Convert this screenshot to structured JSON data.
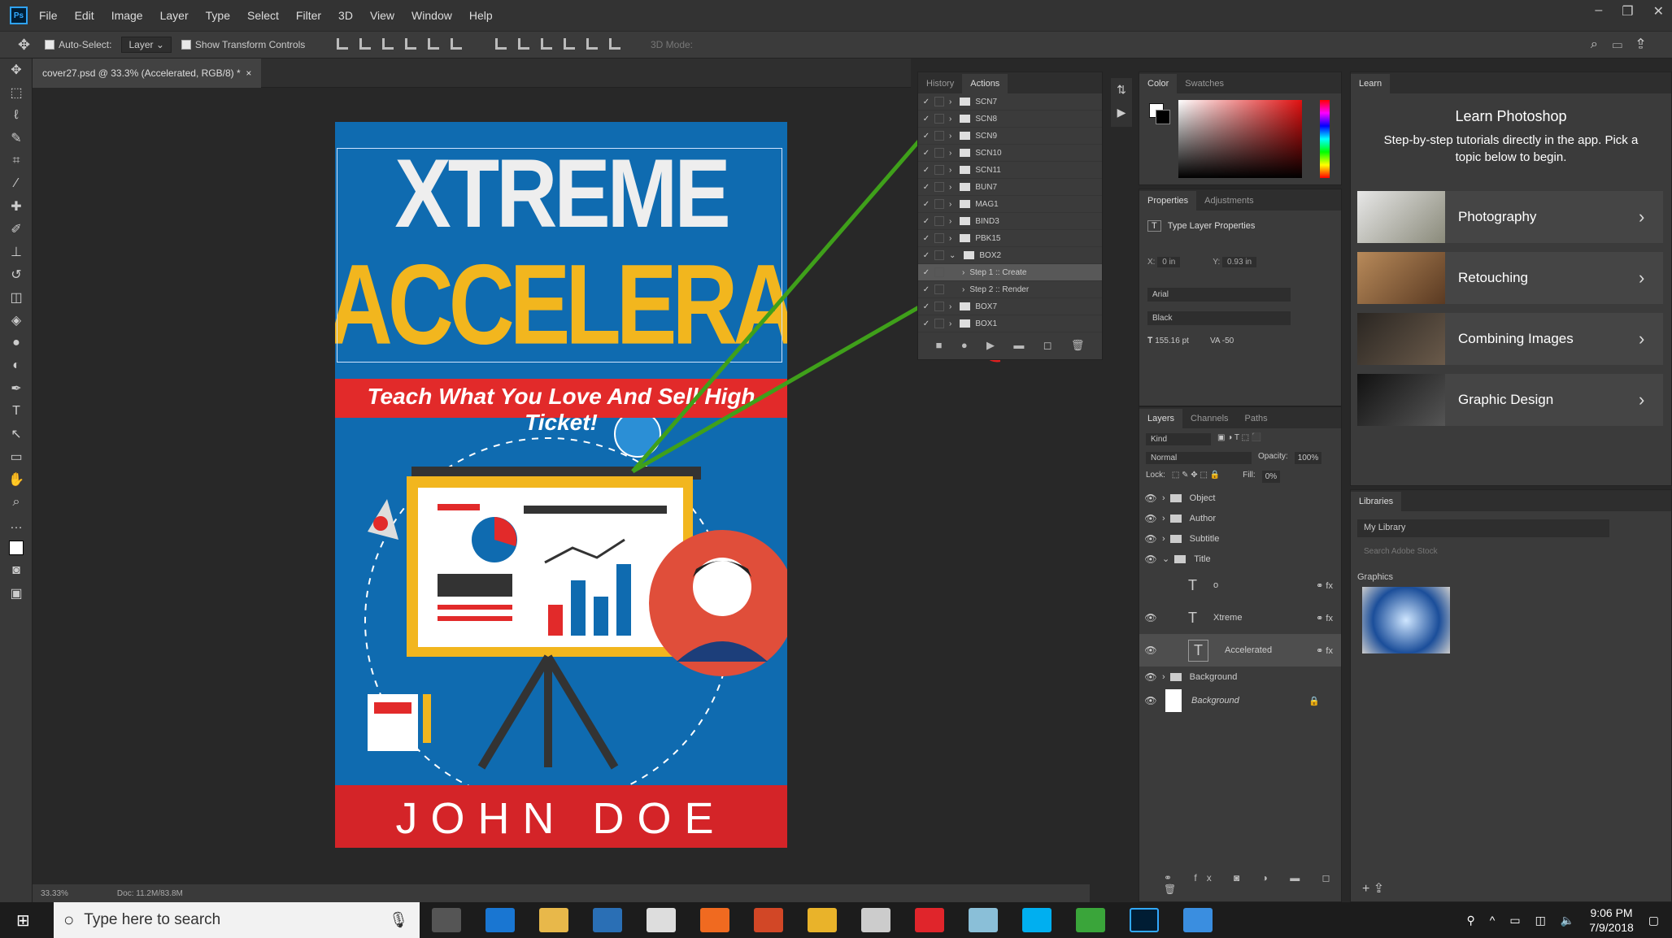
{
  "app": {
    "logo": "Ps"
  },
  "menu": [
    "File",
    "Edit",
    "Image",
    "Layer",
    "Type",
    "Select",
    "Filter",
    "3D",
    "View",
    "Window",
    "Help"
  ],
  "window_controls": [
    "–",
    "❐",
    "✕"
  ],
  "options_bar": {
    "auto_select_label": "Auto-Select:",
    "auto_select_value": "Layer",
    "show_transform_label": "Show Transform Controls",
    "mode_3d": "3D Mode:"
  },
  "document": {
    "tab_label": "cover27.psd @ 33.3% (Accelerated, RGB/8) *",
    "zoom": "33.33%",
    "doc_info": "Doc: 11.2M/83.8M"
  },
  "cover": {
    "title_line1": "XTREME",
    "title_line2": "ACCELERATED",
    "subtitle": "Teach What You Love And Sell High Ticket!",
    "author": "JOHN DOE"
  },
  "actions_panel": {
    "tabs": [
      "History",
      "Actions"
    ],
    "rows": [
      {
        "label": "SCN7"
      },
      {
        "label": "SCN8"
      },
      {
        "label": "SCN9"
      },
      {
        "label": "SCN10"
      },
      {
        "label": "SCN11"
      },
      {
        "label": "BUN7"
      },
      {
        "label": "MAG1"
      },
      {
        "label": "BIND3"
      },
      {
        "label": "PBK15"
      },
      {
        "label": "BOX2"
      },
      {
        "label": "Step 1 :: Create"
      },
      {
        "label": "Step 2 :: Render"
      },
      {
        "label": "BOX7"
      },
      {
        "label": "BOX1"
      }
    ]
  },
  "color_panel": {
    "tabs": [
      "Color",
      "Swatches"
    ]
  },
  "properties_panel": {
    "tabs": [
      "Properties",
      "Adjustments"
    ],
    "heading": "Type Layer Properties",
    "x": "0 in",
    "y": "0.93 in",
    "font": "Arial",
    "style": "Black",
    "size": "155.16 pt",
    "tracking": "-50"
  },
  "layers_panel": {
    "tabs": [
      "Layers",
      "Channels",
      "Paths"
    ],
    "kind": "Kind",
    "blend": "Normal",
    "opacity_label": "Opacity:",
    "opacity": "100%",
    "lock_label": "Lock:",
    "fill_label": "Fill:",
    "fill": "0%",
    "layers": [
      {
        "name": "Object"
      },
      {
        "name": "Author"
      },
      {
        "name": "Subtitle"
      },
      {
        "name": "Title"
      },
      {
        "name": "o"
      },
      {
        "name": "Xtreme"
      },
      {
        "name": "Accelerated"
      },
      {
        "name": "Background"
      },
      {
        "name": "Background"
      }
    ]
  },
  "learn_panel": {
    "tab": "Learn",
    "title": "Learn Photoshop",
    "desc": "Step-by-step tutorials directly in the app. Pick a topic below to begin.",
    "cards": [
      {
        "label": "Photography"
      },
      {
        "label": "Retouching"
      },
      {
        "label": "Combining Images"
      },
      {
        "label": "Graphic Design"
      }
    ]
  },
  "libraries_panel": {
    "tab": "Libraries",
    "library": "My Library",
    "search_placeholder": "Search Adobe Stock",
    "section": "Graphics"
  },
  "taskbar": {
    "search_placeholder": "Type here to search",
    "time": "9:06 PM",
    "date": "7/9/2018"
  }
}
